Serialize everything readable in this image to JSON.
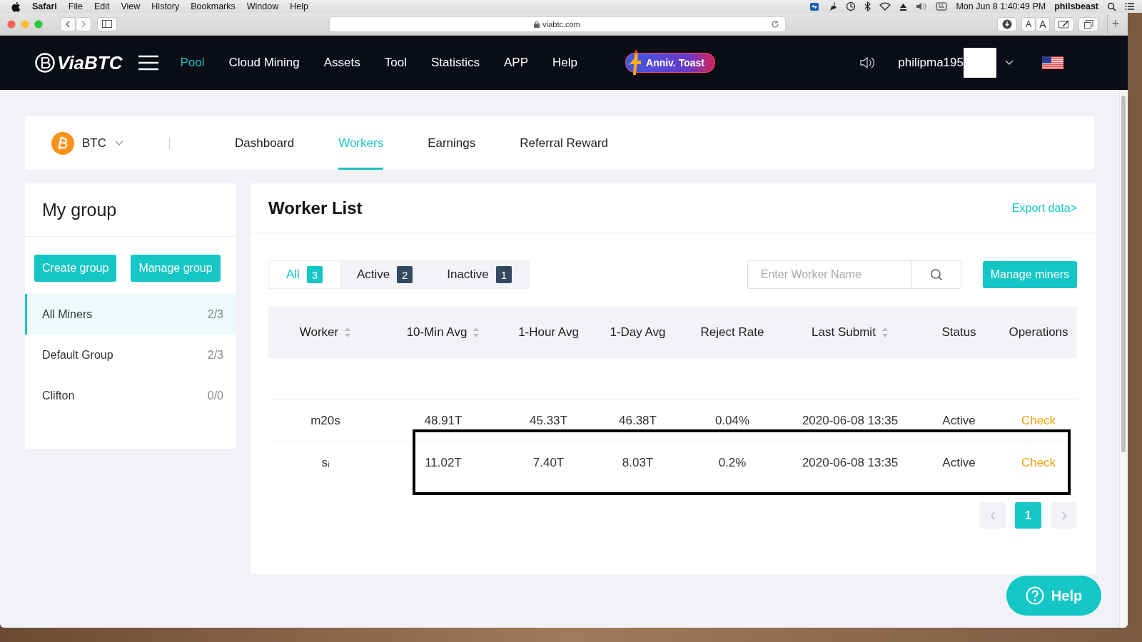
{
  "menu_bar": {
    "app": "Safari",
    "menus": [
      "File",
      "Edit",
      "View",
      "History",
      "Bookmarks",
      "Window",
      "Help"
    ],
    "clock": "Mon Jun 8  1:40:49 PM",
    "user": "philsbeast"
  },
  "browser": {
    "url": "viabtc.com",
    "text_size": [
      "A",
      "A"
    ],
    "new_tab": "+"
  },
  "nav": {
    "logo": "ViaBTC",
    "items": [
      {
        "label": "Pool",
        "selected": true
      },
      {
        "label": "Cloud Mining",
        "selected": false
      },
      {
        "label": "Assets",
        "selected": false
      },
      {
        "label": "Tool",
        "selected": false
      },
      {
        "label": "Statistics",
        "selected": false
      },
      {
        "label": "APP",
        "selected": false
      },
      {
        "label": "Help",
        "selected": false
      }
    ],
    "promo": "Anniv. Toast",
    "username": "philipma195"
  },
  "coin_bar": {
    "coin": "BTC",
    "tabs": [
      {
        "label": "Dashboard",
        "selected": false
      },
      {
        "label": "Workers",
        "selected": true
      },
      {
        "label": "Earnings",
        "selected": false
      },
      {
        "label": "Referral Reward",
        "selected": false
      }
    ]
  },
  "groups": {
    "title": "My group",
    "buttons": [
      "Create group",
      "Manage group"
    ],
    "items": [
      {
        "name": "All Miners",
        "count": "2/3",
        "selected": true
      },
      {
        "name": "Default Group",
        "count": "2/3",
        "selected": false
      },
      {
        "name": "Clifton",
        "count": "0/0",
        "selected": false
      }
    ]
  },
  "workers": {
    "title": "Worker List",
    "export": "Export data>",
    "filters": [
      {
        "label": "All",
        "count": "3",
        "selected": true
      },
      {
        "label": "Active",
        "count": "2",
        "selected": false
      },
      {
        "label": "Inactive",
        "count": "1",
        "selected": false
      }
    ],
    "search": {
      "placeholder": "Enter Worker Name"
    },
    "manage": "Manage miners",
    "columns": [
      {
        "label": "Worker",
        "sortable": true
      },
      {
        "label": "10-Min Avg",
        "sortable": true
      },
      {
        "label": "1-Hour Avg",
        "sortable": false
      },
      {
        "label": "1-Day Avg",
        "sortable": false
      },
      {
        "label": "Reject Rate",
        "sortable": false
      },
      {
        "label": "Last Submit",
        "sortable": true
      },
      {
        "label": "Status",
        "sortable": false
      },
      {
        "label": "Operations",
        "sortable": false
      }
    ],
    "rows": [
      {
        "cells": [
          "m20s",
          "48.91T",
          "45.33T",
          "46.38T",
          "0.04%",
          "2020-06-08 13:35",
          "Active",
          "Check"
        ],
        "highlighted": false
      },
      {
        "cells": [
          "sᵢ",
          "11.02T",
          "7.40T",
          "8.03T",
          "0.2%",
          "2020-06-08 13:35",
          "Active",
          "Check"
        ],
        "highlighted": true
      }
    ],
    "pages": [
      {
        "label": "1",
        "selected": true
      }
    ]
  },
  "help_button": "Help"
}
